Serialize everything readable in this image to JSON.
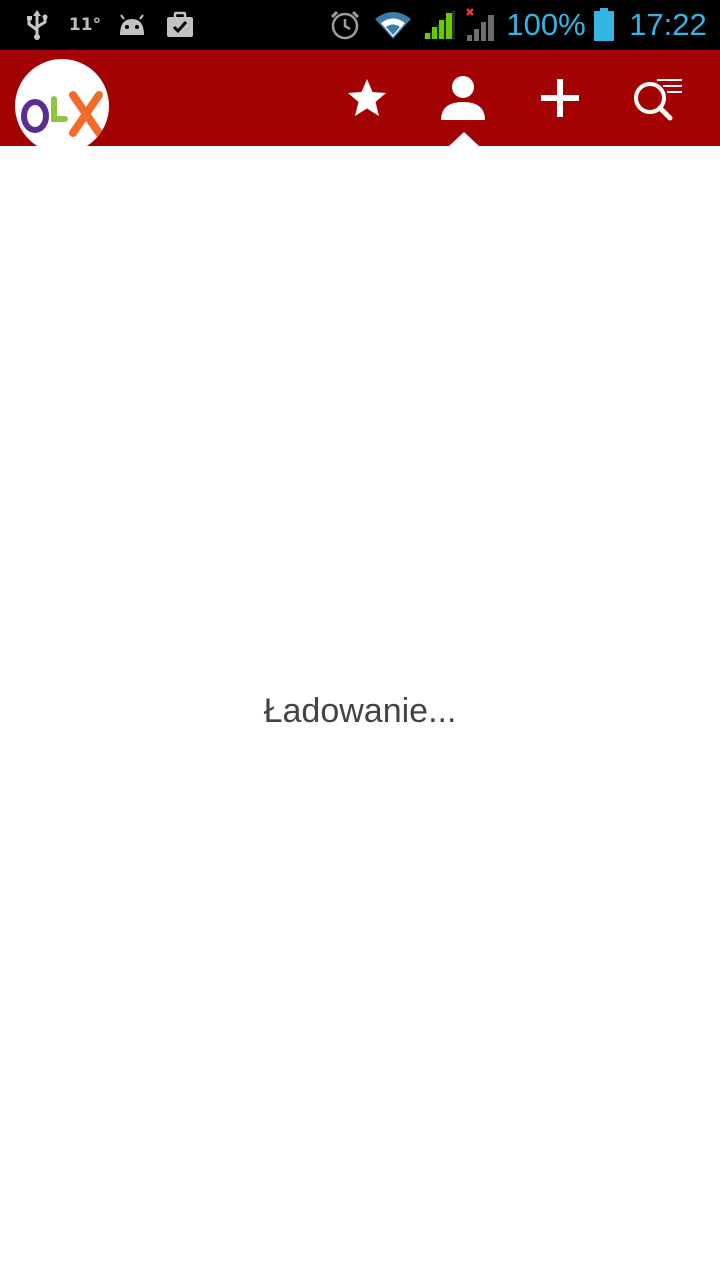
{
  "status_bar": {
    "temperature": "11°",
    "battery_percent": "100%",
    "battery_level": 1.0,
    "time": "17:22",
    "icons": [
      "usb-icon",
      "temperature-icon",
      "android-icon",
      "task-icon",
      "alarm-icon",
      "wifi-icon",
      "signal-icon",
      "signal-no-service-icon",
      "battery-icon"
    ],
    "accent_color": "#33b5e5"
  },
  "app_bar": {
    "logo_text": "OLX",
    "logo_colors": {
      "o": "#5a2d91",
      "l": "#8dc63f",
      "x": "#f26b2a"
    },
    "background_color": "#a30202",
    "actions": [
      "star-icon",
      "person-icon",
      "plus-icon",
      "search-filter-icon"
    ],
    "active_action": "person-icon"
  },
  "main": {
    "loading_text": "Ładowanie..."
  }
}
